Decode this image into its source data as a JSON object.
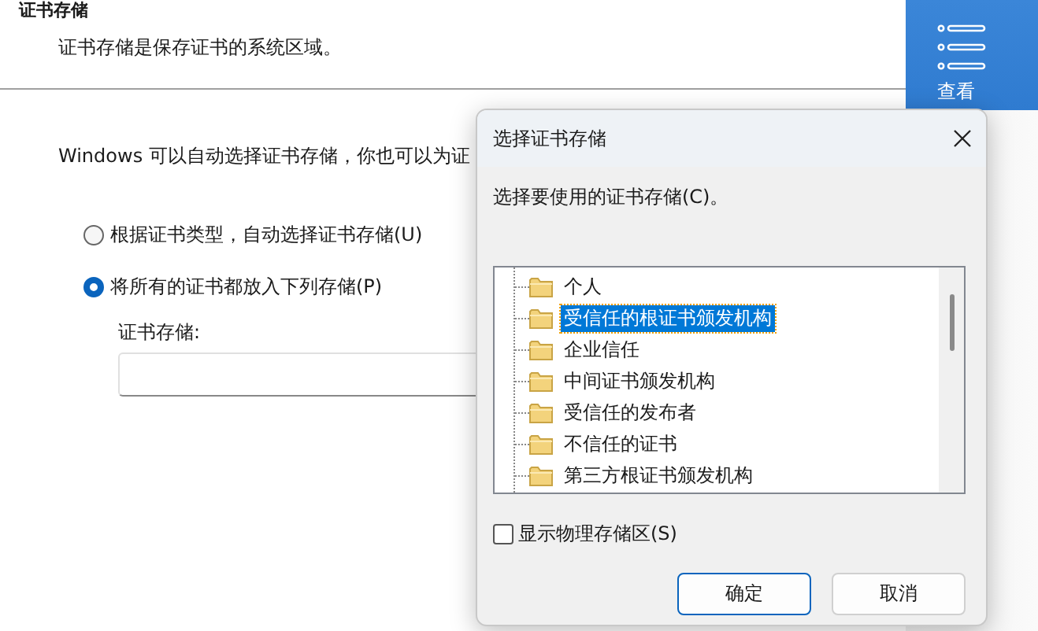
{
  "header": {
    "title": "证书存储",
    "description": "证书存储是保存证书的系统区域。"
  },
  "side_panel": {
    "label": "查看"
  },
  "intro": "Windows 可以自动选择证书存储，你也可以为证",
  "options": [
    {
      "label": "根据证书类型，自动选择证书存储(U)",
      "selected": false
    },
    {
      "label": "将所有的证书都放入下列存储(P)",
      "selected": true
    }
  ],
  "store_field": {
    "label": "证书存储:"
  },
  "dialog": {
    "title": "选择证书存储",
    "prompt": "选择要使用的证书存储(C)。",
    "stores": [
      {
        "label": "个人",
        "selected": false
      },
      {
        "label": "受信任的根证书颁发机构",
        "selected": true
      },
      {
        "label": "企业信任",
        "selected": false
      },
      {
        "label": "中间证书颁发机构",
        "selected": false
      },
      {
        "label": "受信任的发布者",
        "selected": false
      },
      {
        "label": "不信任的证书",
        "selected": false
      },
      {
        "label": "第三方根证书颁发机构",
        "selected": false
      }
    ],
    "show_physical": {
      "label": "显示物理存储区(S)",
      "checked": false
    },
    "buttons": [
      {
        "label": "确定",
        "default": true
      },
      {
        "label": "取消",
        "default": false
      }
    ]
  }
}
